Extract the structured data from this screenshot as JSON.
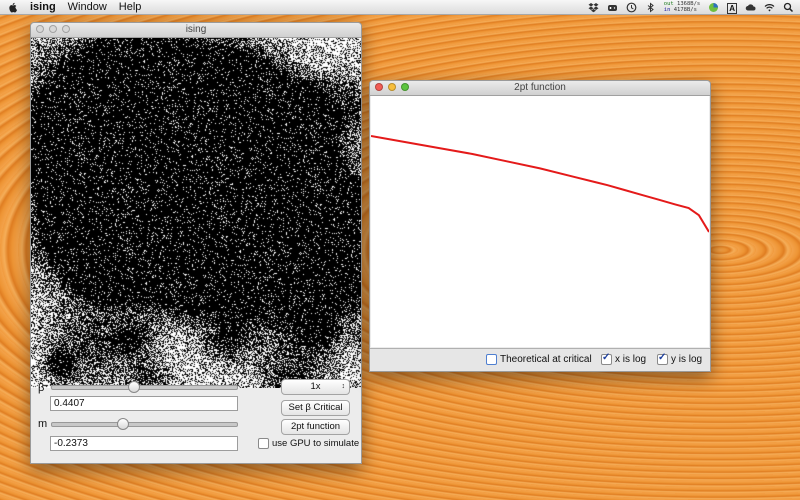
{
  "menubar": {
    "app_name": "ising",
    "items": [
      "Window",
      "Help"
    ],
    "net_out": "1368B/s",
    "net_in": "4178B/s",
    "out_label": "out",
    "in_label": "in",
    "input_letter": "A"
  },
  "ising_window": {
    "title": "ising",
    "beta_label": "β",
    "beta_value": "0.4407",
    "beta_slider_fraction": 0.44,
    "m_label": "m",
    "m_value": "-0.2373",
    "m_slider_fraction": 0.38,
    "speed_popup": "1x",
    "set_beta_button": "Set β Critical",
    "twopt_button": "2pt function",
    "gpu_checkbox_label": "use GPU to simulate",
    "gpu_checked": false
  },
  "twopt_window": {
    "title": "2pt function",
    "theoretical_label": "Theoretical at critical",
    "theoretical_checked": false,
    "xlog_label": "x is log",
    "xlog_checked": true,
    "ylog_label": "y is log",
    "ylog_checked": true
  },
  "chart_data": {
    "type": "line",
    "series": [
      {
        "color": "#e41a1a",
        "x": [
          0,
          0.1,
          0.2,
          0.3,
          0.4,
          0.5,
          0.6,
          0.7,
          0.75,
          0.8,
          0.85,
          0.9,
          0.94,
          0.97,
          1.0
        ],
        "y": [
          1.0,
          0.95,
          0.9,
          0.85,
          0.79,
          0.73,
          0.66,
          0.59,
          0.55,
          0.51,
          0.47,
          0.43,
          0.4,
          0.34,
          0.2
        ]
      }
    ],
    "xlog": true,
    "ylog": true,
    "grid": false
  }
}
